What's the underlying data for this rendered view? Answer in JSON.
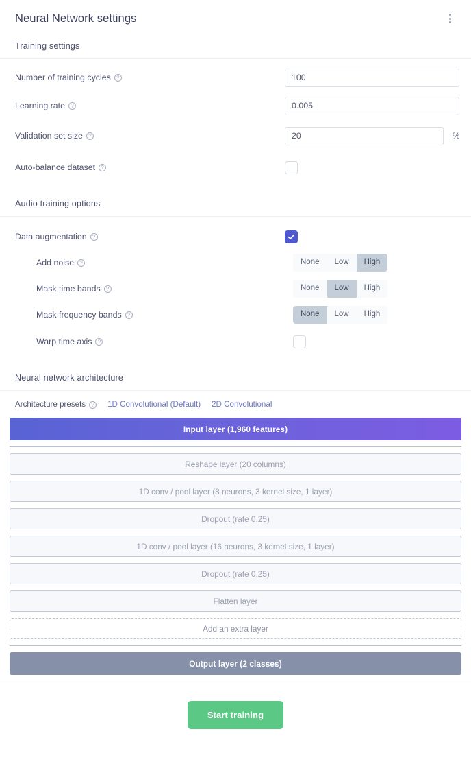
{
  "header": {
    "title": "Neural Network settings",
    "menu_icon": "kebab-menu-icon"
  },
  "training_settings": {
    "heading": "Training settings",
    "fields": [
      {
        "label": "Number of training cycles",
        "help": "?",
        "value": "100",
        "type": "text"
      },
      {
        "label": "Learning rate",
        "help": "?",
        "value": "0.005",
        "type": "text"
      },
      {
        "label": "Validation set size",
        "help": "?",
        "value": "20",
        "type": "text",
        "suffix": "%"
      },
      {
        "label": "Auto-balance dataset",
        "help": "?",
        "checked": false,
        "type": "checkbox"
      }
    ]
  },
  "audio_training_options": {
    "heading": "Audio training options",
    "data_augmentation": {
      "label": "Data augmentation",
      "help": "?",
      "checked": true
    },
    "sub_options": [
      {
        "label": "Add noise",
        "help": "?",
        "type": "segmented",
        "options": [
          "None",
          "Low",
          "High"
        ],
        "selected": "High"
      },
      {
        "label": "Mask time bands",
        "help": "?",
        "type": "segmented",
        "options": [
          "None",
          "Low",
          "High"
        ],
        "selected": "Low"
      },
      {
        "label": "Mask frequency bands",
        "help": "?",
        "type": "segmented",
        "options": [
          "None",
          "Low",
          "High"
        ],
        "selected": "None"
      },
      {
        "label": "Warp time axis",
        "help": "?",
        "type": "checkbox",
        "checked": false
      }
    ]
  },
  "architecture": {
    "heading": "Neural network architecture",
    "presets_label": "Architecture presets",
    "presets_help": "?",
    "presets": [
      {
        "label": "1D Convolutional (Default)"
      },
      {
        "label": "2D Convolutional"
      }
    ],
    "input_layer": "Input layer (1,960 features)",
    "hidden_layers": [
      "Reshape layer (20 columns)",
      "1D conv / pool layer (8 neurons, 3 kernel size, 1 layer)",
      "Dropout (rate 0.25)",
      "1D conv / pool layer (16 neurons, 3 kernel size, 1 layer)",
      "Dropout (rate 0.25)",
      "Flatten layer"
    ],
    "add_layer": "Add an extra layer",
    "output_layer": "Output layer (2 classes)"
  },
  "footer": {
    "start_training": "Start training"
  },
  "colors": {
    "accent_indigo": "#4d57cf",
    "input_layer_start": "#5863d4",
    "input_layer_end": "#7c5ce2",
    "output_layer": "#8690a8",
    "start_button_green": "#5cc885",
    "link_blue": "#6b78c4",
    "segment_selected": "#c4ced9"
  }
}
